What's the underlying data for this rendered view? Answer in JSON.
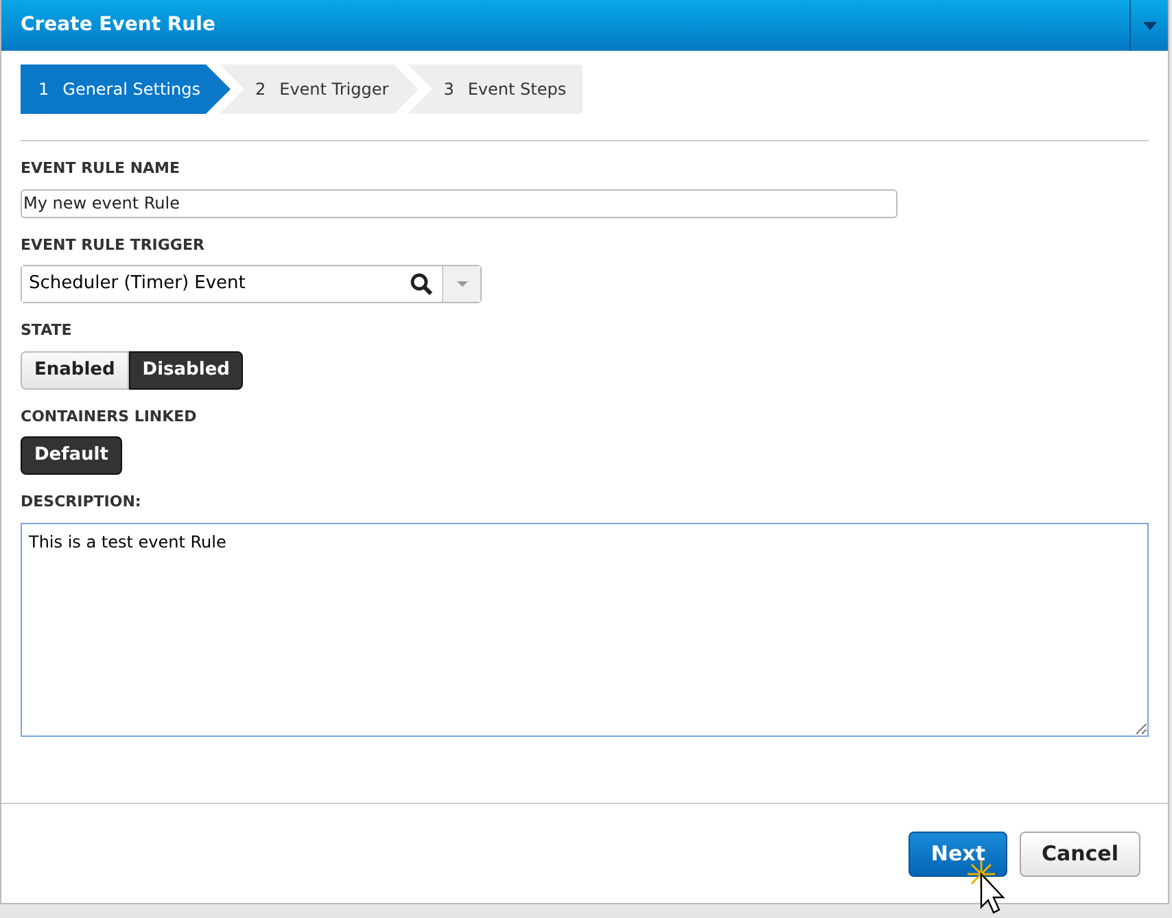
{
  "window": {
    "title": "Create Event Rule"
  },
  "steps": [
    {
      "number": "1",
      "label": "General Settings",
      "selected": true
    },
    {
      "number": "2",
      "label": "Event Trigger",
      "selected": false
    },
    {
      "number": "3",
      "label": "Event Steps",
      "selected": false
    }
  ],
  "name_field": {
    "label": "EVENT RULE NAME",
    "value": "My new event Rule"
  },
  "trigger_field": {
    "label": "EVENT RULE TRIGGER",
    "value": "Scheduler (Timer) Event"
  },
  "state": {
    "label": "STATE",
    "options": [
      {
        "label": "Enabled",
        "selected": false
      },
      {
        "label": "Disabled",
        "selected": true
      }
    ]
  },
  "containers": {
    "label": "CONTAINERS LINKED",
    "options": [
      {
        "label": "Default",
        "selected": true
      }
    ]
  },
  "description": {
    "label": "DESCRIPTION:",
    "value": "This is a test event Rule"
  },
  "buttons": [
    {
      "label": "Next",
      "kind": "primary"
    },
    {
      "label": "Cancel",
      "kind": "default"
    }
  ]
}
